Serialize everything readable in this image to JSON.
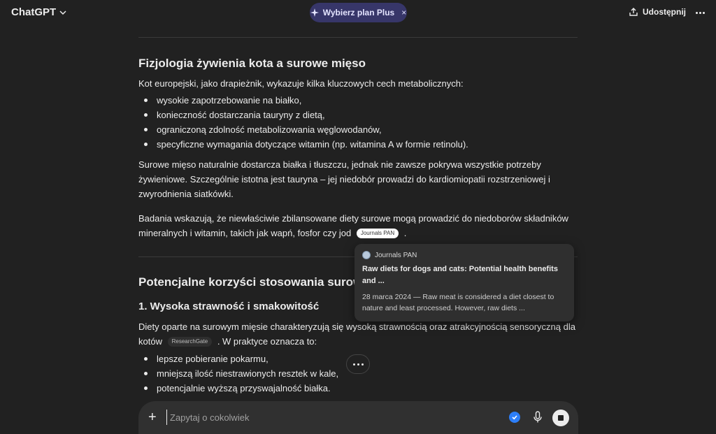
{
  "header": {
    "brand": "ChatGPT",
    "plan_label": "Wybierz plan Plus",
    "plan_close": "×",
    "share_label": "Udostępnij"
  },
  "section1": {
    "title": "Fizjologia żywienia kota a surowe mięso",
    "intro": "Kot europejski, jako drapieżnik, wykazuje kilka kluczowych cech metabolicznych:",
    "bullets": [
      "wysokie zapotrzebowanie na białko,",
      "konieczność dostarczania tauryny z dietą,",
      "ograniczoną zdolność metabolizowania węglowodanów,",
      "specyficzne wymagania dotyczące witamin (np. witamina A w formie retinolu)."
    ],
    "para1": "Surowe mięso naturalnie dostarcza białka i tłuszczu, jednak nie zawsze pokrywa wszystkie potrzeby żywieniowe. Szczególnie istotna jest tauryna – jej niedobór prowadzi do kardiomiopatii rozstrzeniowej i zwyrodnienia siatkówki.",
    "para2": "Badania wskazują, że niewłaściwie zbilansowane diety surowe mogą prowadzić do niedoborów składników mineralnych i witamin, takich jak wapń, fosfor czy jod",
    "para2_cite": "Journals PAN",
    "para2_end": "."
  },
  "tooltip": {
    "source": "Journals PAN",
    "title": "Raw diets for dogs and cats: Potential health benefits and ...",
    "snippet": "28 marca 2024 — Raw meat is considered a diet closest to nature and least processed. However, raw diets ..."
  },
  "section2": {
    "title": "Potencjalne korzyści stosowania surowego",
    "subtitle": "1. Wysoka strawność i smakowitość",
    "para": "Diety oparte na surowym mięsie charakteryzują się wysoką strawnością oraz atrakcyjnością sensoryczną dla kotów",
    "cite": "ResearchGate",
    "para_end": ". W praktyce oznacza to:",
    "bullets": [
      "lepsze pobieranie pokarmu,",
      "mniejszą ilość niestrawionych resztek w kale,",
      "potencjalnie wyższą przyswajalność białka."
    ]
  },
  "composer": {
    "plus": "+",
    "placeholder": "Zapytaj o cokolwiek"
  },
  "colors": {
    "background": "#212121",
    "plan_pill": "#373669",
    "accent_check": "#2d7ff9"
  }
}
